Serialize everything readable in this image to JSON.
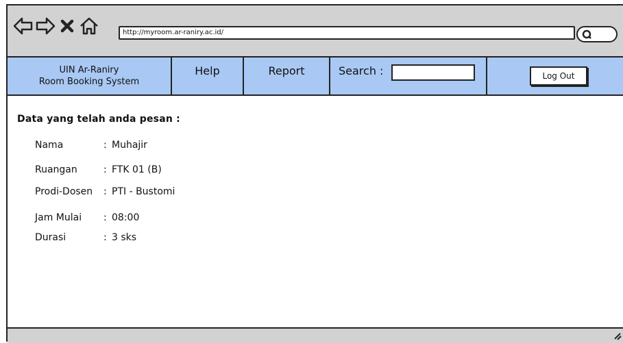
{
  "browser": {
    "url": "http://myroom.ar-raniry.ac.id/",
    "icons": [
      "back-arrow-icon",
      "forward-arrow-icon",
      "close-icon",
      "home-icon",
      "search-icon"
    ]
  },
  "nav": {
    "brand_line1": "UIN Ar-Raniry",
    "brand_line2": "Room Booking System",
    "help": "Help",
    "report": "Report",
    "search_label": "Search :",
    "search_value": "",
    "logout": "Log Out"
  },
  "booking": {
    "heading": "Data yang telah anda pesan :",
    "fields": [
      {
        "label": "Nama",
        "value": "Muhajir"
      },
      {
        "label": "Ruangan",
        "value": "FTK 01 (B)"
      },
      {
        "label": "Prodi-Dosen",
        "value": "PTI - Bustomi"
      },
      {
        "label": "Jam Mulai",
        "value": "08:00"
      },
      {
        "label": "Durasi",
        "value": "3 sks"
      }
    ]
  }
}
